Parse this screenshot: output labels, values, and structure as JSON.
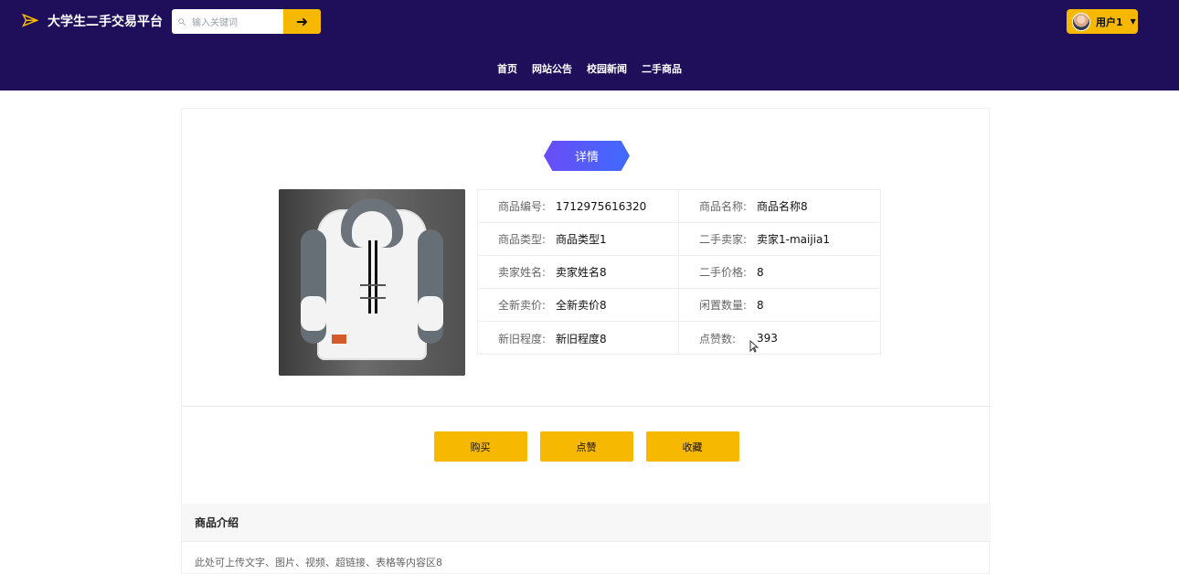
{
  "header": {
    "title": "大学生二手交易平台",
    "search": {
      "placeholder": "输入关键词"
    },
    "user": {
      "label": "用户1"
    }
  },
  "nav": {
    "items": [
      "首页",
      "网站公告",
      "校园新闻",
      "二手商品"
    ]
  },
  "detail": {
    "tag": "详情",
    "fields": [
      {
        "label": "商品编号:",
        "value": "1712975616320"
      },
      {
        "label": "商品名称:",
        "value": "商品名称8"
      },
      {
        "label": "商品类型:",
        "value": "商品类型1"
      },
      {
        "label": "二手卖家:",
        "value": "卖家1-maijia1"
      },
      {
        "label": "卖家姓名:",
        "value": "卖家姓名8"
      },
      {
        "label": "二手价格:",
        "value": "8"
      },
      {
        "label": "全新卖价:",
        "value": "全新卖价8"
      },
      {
        "label": "闲置数量:",
        "value": "8"
      },
      {
        "label": "新旧程度:",
        "value": "新旧程度8"
      },
      {
        "label": "点赞数:",
        "value": "393"
      }
    ],
    "buttons": {
      "buy": "购买",
      "like": "点赞",
      "fav": "收藏"
    }
  },
  "intro": {
    "title": "商品介绍",
    "content": "此处可上传文字、图片、视频、超链接、表格等内容区8"
  },
  "colors": {
    "header_bg": "#1f0e5a",
    "accent": "#f6b800",
    "tag_gradient_start": "#6a4cf6",
    "tag_gradient_end": "#3f6bff"
  }
}
